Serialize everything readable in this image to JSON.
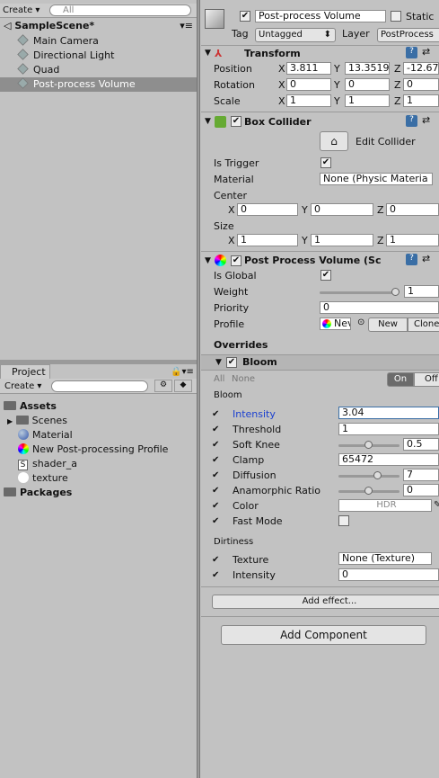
{
  "hierarchy": {
    "create": "Create",
    "search_placeholder": "All",
    "scene": "SampleScene*",
    "items": [
      "Main Camera",
      "Directional Light",
      "Quad",
      "Post-process Volume"
    ]
  },
  "project": {
    "tab": "Project",
    "create": "Create",
    "assets": "Assets",
    "items": [
      "Scenes",
      "Material",
      "New Post-processing Profile",
      "shader_a",
      "texture"
    ],
    "packages": "Packages"
  },
  "inspector": {
    "object_name": "Post-process Volume",
    "static_label": "Static",
    "tag_label": "Tag",
    "tag_value": "Untagged",
    "layer_label": "Layer",
    "layer_value": "PostProcess",
    "transform": {
      "title": "Transform",
      "position_label": "Position",
      "rotation_label": "Rotation",
      "scale_label": "Scale",
      "position": [
        "3.811",
        "13.3519",
        "-12.67"
      ],
      "rotation": [
        "0",
        "0",
        "0"
      ],
      "scale": [
        "1",
        "1",
        "1"
      ],
      "axis": [
        "X",
        "Y",
        "Z"
      ]
    },
    "box_collider": {
      "title": "Box Collider",
      "edit": "Edit Collider",
      "is_trigger": "Is Trigger",
      "material_label": "Material",
      "material_value": "None (Physic Materia",
      "center_label": "Center",
      "center": [
        "0",
        "0",
        "0"
      ],
      "size_label": "Size",
      "size": [
        "1",
        "1",
        "1"
      ]
    },
    "ppv": {
      "title": "Post Process Volume (Sc",
      "is_global": "Is Global",
      "weight_label": "Weight",
      "weight_value": "1",
      "weight_fraction": 1,
      "priority_label": "Priority",
      "priority_value": "0",
      "profile_label": "Profile",
      "profile_value": "Nev",
      "new_btn": "New",
      "clone_btn": "Clone",
      "overrides": "Overrides",
      "bloom_title": "Bloom",
      "all": "All",
      "none": "None",
      "on": "On",
      "off": "Off",
      "bloom_group": "Bloom",
      "intensity_label": "Intensity",
      "intensity_value": "3.04",
      "threshold_label": "Threshold",
      "threshold_value": "1",
      "softknee_label": "Soft Knee",
      "softknee_value": "0.5",
      "clamp_label": "Clamp",
      "clamp_value": "65472",
      "diffusion_label": "Diffusion",
      "diffusion_value": "7",
      "anamorphic_label": "Anamorphic Ratio",
      "anamorphic_value": "0",
      "color_label": "Color",
      "color_value": "HDR",
      "fastmode_label": "Fast Mode",
      "dirtiness_group": "Dirtiness",
      "texture_label": "Texture",
      "texture_value": "None (Texture)",
      "dirt_intensity_label": "Intensity",
      "dirt_intensity_value": "0",
      "add_effect": "Add effect..."
    },
    "add_component": "Add Component"
  }
}
